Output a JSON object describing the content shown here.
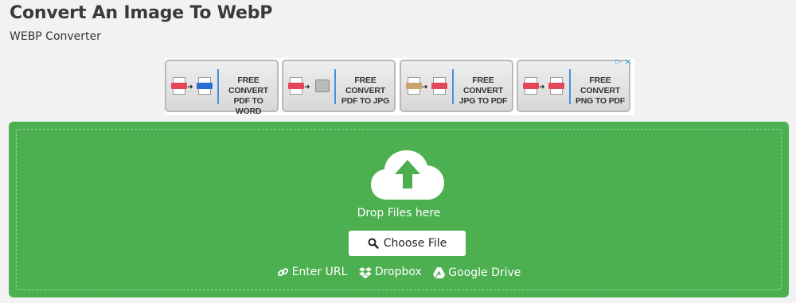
{
  "header": {
    "title": "Convert An Image To WebP",
    "subtitle": "WEBP Converter"
  },
  "ad": {
    "items": [
      {
        "line1": "FREE CONVERT",
        "line2": "PDF TO WORD",
        "from_icon": "pdf-doc-icon",
        "to_icon": "word-doc-icon"
      },
      {
        "line1": "FREE CONVERT",
        "line2": "PDF TO JPG",
        "from_icon": "pdf-doc-icon",
        "to_icon": "printer-icon"
      },
      {
        "line1": "FREE CONVERT",
        "line2": "JPG TO PDF",
        "from_icon": "jpg-doc-icon",
        "to_icon": "pdf-doc-icon"
      },
      {
        "line1": "FREE CONVERT",
        "line2": "PNG TO PDF",
        "from_icon": "png-doc-icon",
        "to_icon": "pdf-doc-icon"
      }
    ],
    "info_icon": "ad-info-icon",
    "close_icon": "ad-close-icon"
  },
  "dropzone": {
    "background": "#4caf50",
    "upload_icon": "cloud-upload-icon",
    "drop_text": "Drop Files here",
    "choose_button_label": "Choose File",
    "sources": [
      {
        "label": "Enter URL",
        "icon": "link-icon"
      },
      {
        "label": "Dropbox",
        "icon": "dropbox-icon"
      },
      {
        "label": "Google Drive",
        "icon": "google-drive-icon"
      }
    ]
  }
}
